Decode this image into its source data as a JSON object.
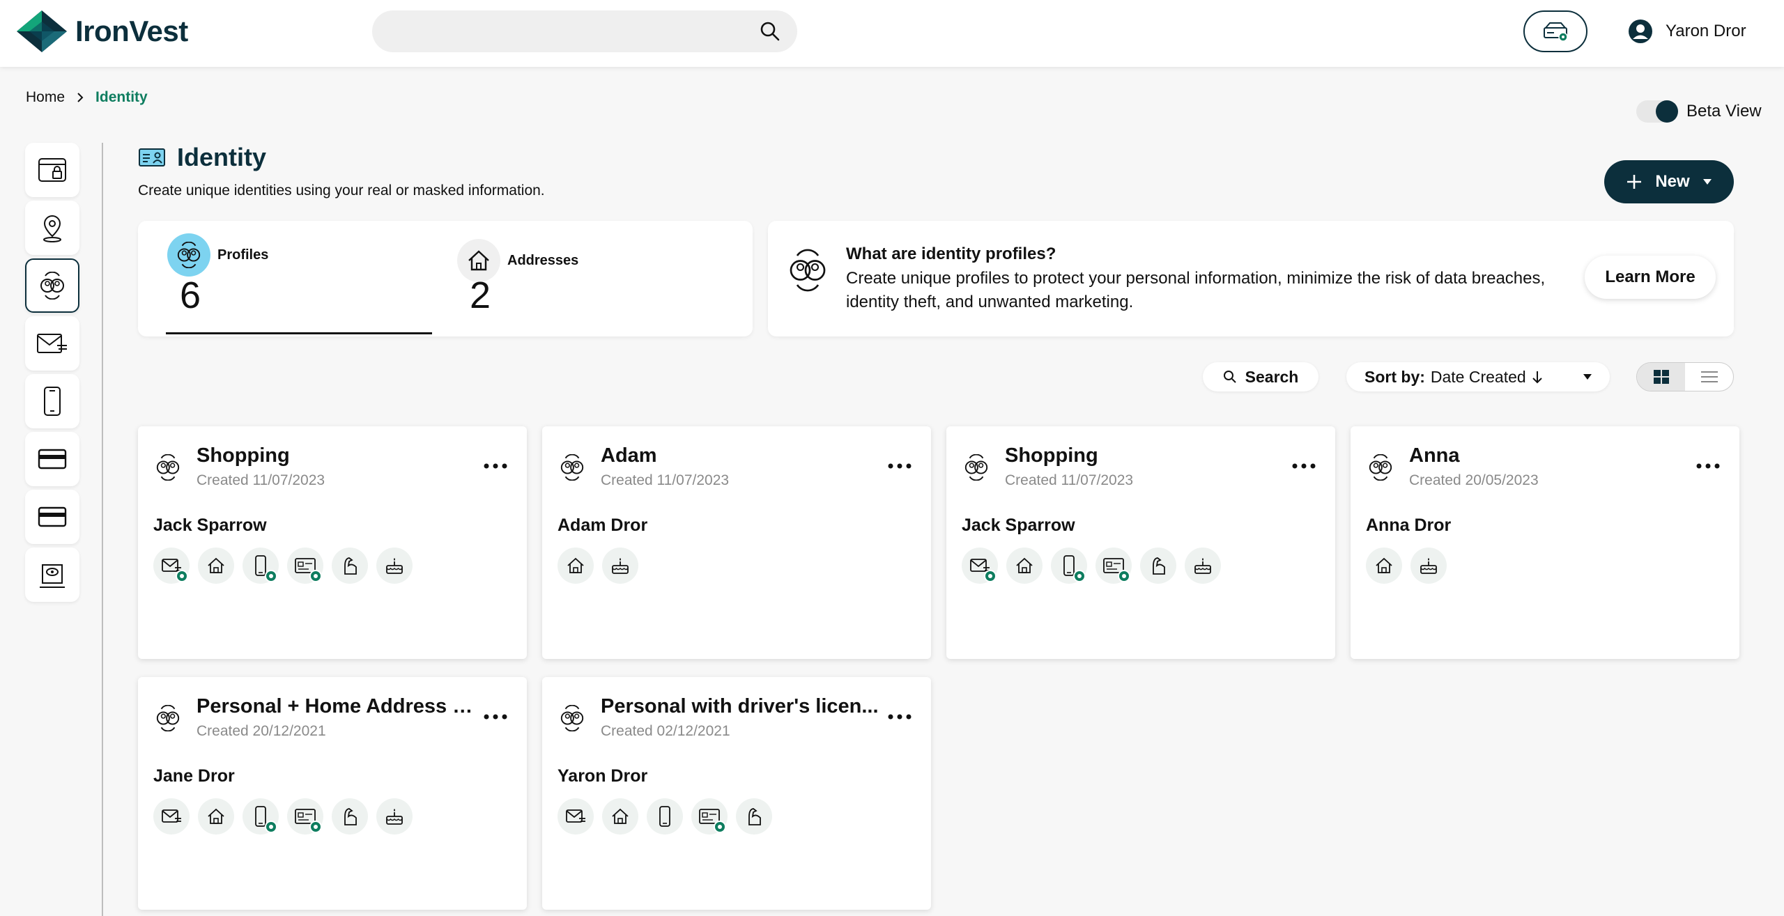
{
  "app": {
    "name": "IronVest"
  },
  "header": {
    "search": {
      "placeholder": ""
    },
    "user_name": "Yaron Dror"
  },
  "breadcrumb": {
    "home": "Home",
    "current": "Identity"
  },
  "beta_view": {
    "label": "Beta View",
    "enabled": true
  },
  "page": {
    "title": "Identity",
    "subtitle": "Create unique identities using your real or masked information.",
    "new_button": "New"
  },
  "stats": {
    "profiles": {
      "label": "Profiles",
      "count": "6"
    },
    "addresses": {
      "label": "Addresses",
      "count": "2"
    }
  },
  "info": {
    "question": "What are identity profiles?",
    "description": "Create unique profiles to protect your personal information, minimize the risk of data breaches, identity theft, and unwanted marketing.",
    "learn_more": "Learn More"
  },
  "toolbar": {
    "search_label": "Search",
    "sort_prefix": "Sort by:",
    "sort_value": "Date Created"
  },
  "colors": {
    "brand": "#0c2f3c",
    "accent": "#0e7d5f",
    "profiles_circle": "#7dd3f0"
  },
  "cards": [
    {
      "title": "Shopping",
      "created": "Created 11/07/2023",
      "person": "Jack Sparrow",
      "icons": [
        "email-masked-icon",
        "home-icon",
        "phone-masked-icon",
        "card-masked-icon",
        "arm-icon",
        "cake-icon"
      ]
    },
    {
      "title": "Adam",
      "created": "Created 11/07/2023",
      "person": "Adam Dror",
      "icons": [
        "home-icon",
        "cake-icon"
      ]
    },
    {
      "title": "Shopping",
      "created": "Created 11/07/2023",
      "person": "Jack Sparrow",
      "icons": [
        "email-masked-icon",
        "home-icon",
        "phone-masked-icon",
        "card-masked-icon",
        "arm-icon",
        "cake-icon"
      ]
    },
    {
      "title": "Anna",
      "created": "Created 20/05/2023",
      "person": "Anna Dror",
      "icons": [
        "home-icon",
        "cake-icon"
      ]
    },
    {
      "title": "Personal + Home Address (...",
      "created": "Created 20/12/2021",
      "person": "Jane Dror",
      "icons": [
        "email-icon",
        "home-icon",
        "phone-masked-icon",
        "card-masked-icon",
        "arm-icon",
        "cake-icon"
      ]
    },
    {
      "title": "Personal with driver's licen...",
      "created": "Created 02/12/2021",
      "person": "Yaron Dror",
      "icons": [
        "email-icon",
        "home-icon",
        "phone-icon",
        "card-masked-icon",
        "arm-icon"
      ]
    }
  ]
}
